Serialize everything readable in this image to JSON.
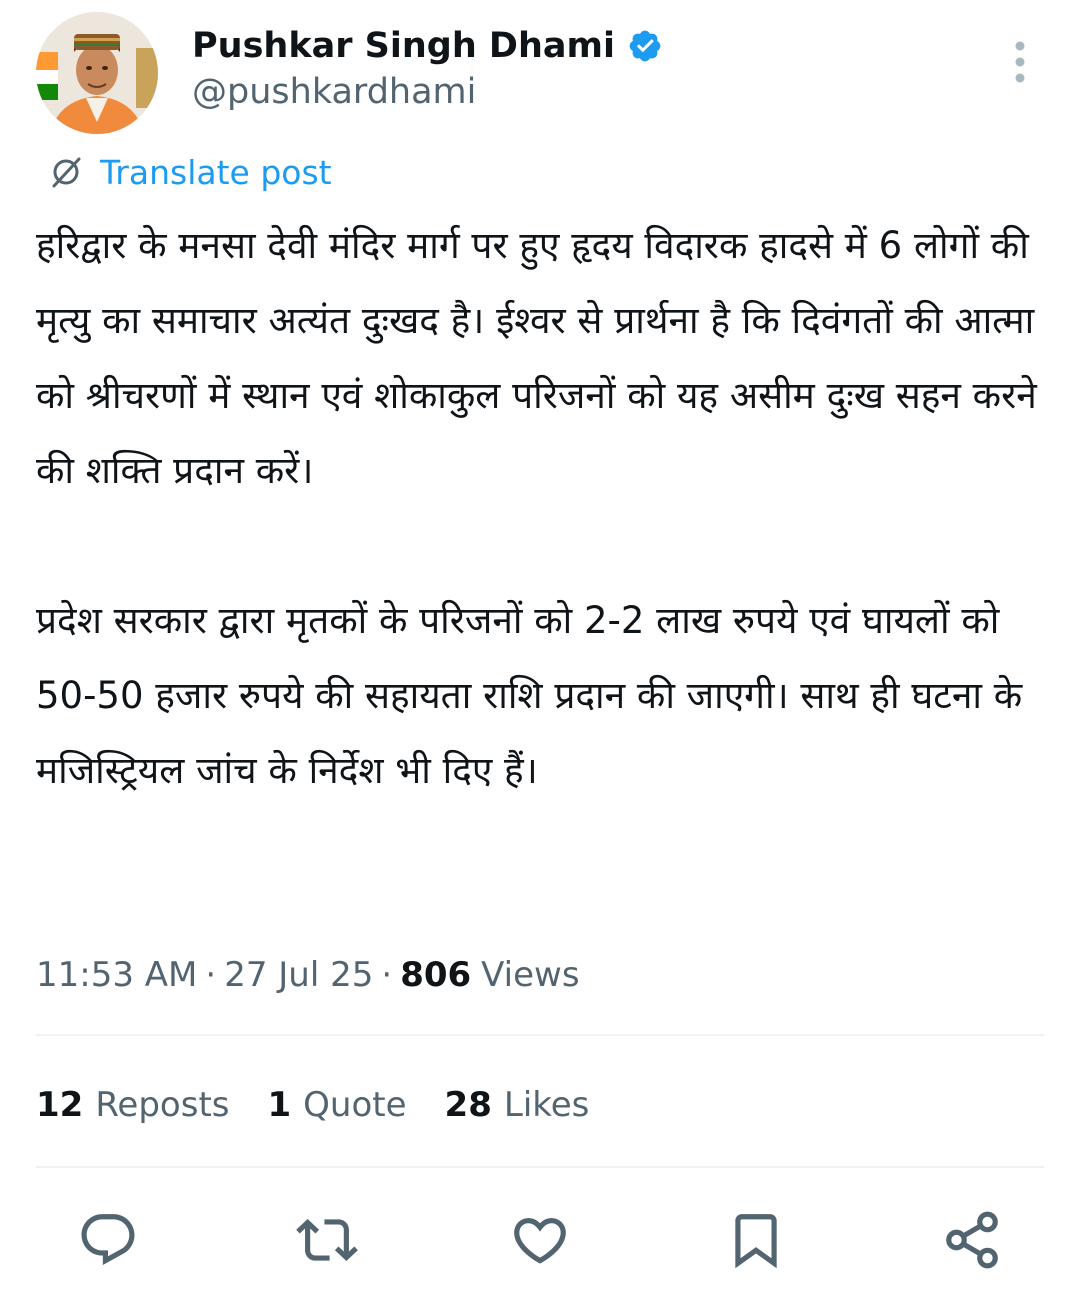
{
  "author": {
    "display_name": "Pushkar Singh Dhami",
    "handle": "@pushkardhami",
    "verified": true
  },
  "translate": {
    "label": "Translate post"
  },
  "post": {
    "paragraph_1": "हरिद्वार के मनसा देवी मंदिर मार्ग पर हुए हृदय विदारक हादसे में 6 लोगों की मृत्यु का समाचार अत्यंत दुःखद है। ईश्वर से प्रार्थना है कि दिवंगतों की आत्मा को श्रीचरणों में स्थान एवं शोकाकुल परिजनों को यह असीम दुःख सहन करने की शक्ति प्रदान करें।",
    "paragraph_2": "प्रदेश सरकार द्वारा मृतकों के परिजनों को 2-2 लाख रुपये एवं घायलों को 50-50 हजार रुपये की सहायता राशि प्रदान की जाएगी। साथ ही घटना के मजिस्ट्रियल जांच के निर्देश भी दिए हैं।"
  },
  "meta": {
    "time": "11:53 AM",
    "date": "27 Jul 25",
    "separator": "·",
    "views_count": "806",
    "views_label": "Views"
  },
  "stats": {
    "reposts_count": "12",
    "reposts_label": "Reposts",
    "quotes_count": "1",
    "quotes_label": "Quote",
    "likes_count": "28",
    "likes_label": "Likes"
  },
  "colors": {
    "text_primary": "#0f1419",
    "text_secondary": "#536471",
    "accent_blue": "#1d9bf0",
    "divider": "#eff3f4",
    "icon_gray": "#536471"
  },
  "icons": {
    "verified": "verified-badge-icon",
    "more": "more-vertical-icon",
    "translate": "translate-icon",
    "reply": "reply-icon",
    "repost": "repost-icon",
    "like": "heart-icon",
    "bookmark": "bookmark-icon",
    "share": "share-icon"
  }
}
